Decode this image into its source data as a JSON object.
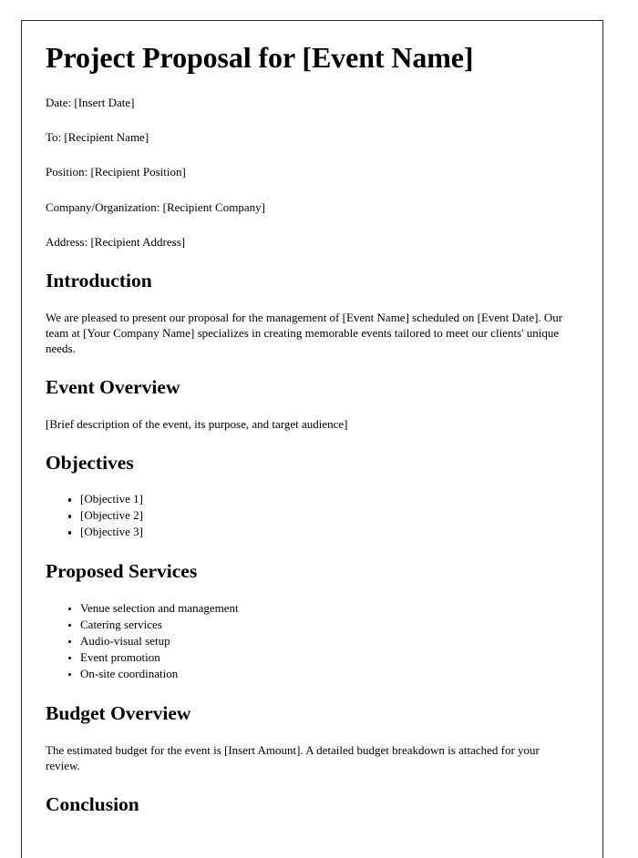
{
  "document": {
    "title": "Project Proposal for [Event Name]",
    "metadata": [
      {
        "label": "Date:",
        "value": "[Insert Date]",
        "text": "Date: [Insert Date]"
      },
      {
        "label": "To:",
        "value": "[Recipient Name]",
        "text": "To: [Recipient Name]"
      },
      {
        "label": "Position:",
        "value": "[Recipient Position]",
        "text": "Position: [Recipient Position]"
      },
      {
        "label": "Company/Organization:",
        "value": "[Recipient Company]",
        "text": "Company/Organization: [Recipient Company]"
      },
      {
        "label": "Address:",
        "value": "[Recipient Address]",
        "text": "Address: [Recipient Address]"
      }
    ],
    "sections": {
      "introduction": {
        "heading": "Introduction",
        "paragraph": "We are pleased to present our proposal for the management of [Event Name] scheduled on [Event Date]. Our team at [Your Company Name] specializes in creating memorable events tailored to meet our clients' unique needs."
      },
      "event_overview": {
        "heading": "Event Overview",
        "paragraph": "[Brief description of the event, its purpose, and target audience]"
      },
      "objectives": {
        "heading": "Objectives",
        "items": [
          "[Objective 1]",
          "[Objective 2]",
          "[Objective 3]"
        ]
      },
      "proposed_services": {
        "heading": "Proposed Services",
        "items": [
          "Venue selection and management",
          "Catering services",
          "Audio-visual setup",
          "Event promotion",
          "On-site coordination"
        ]
      },
      "budget_overview": {
        "heading": "Budget Overview",
        "paragraph": "The estimated budget for the event is [Insert Amount]. A detailed budget breakdown is attached for your review."
      },
      "conclusion": {
        "heading": "Conclusion"
      }
    }
  }
}
